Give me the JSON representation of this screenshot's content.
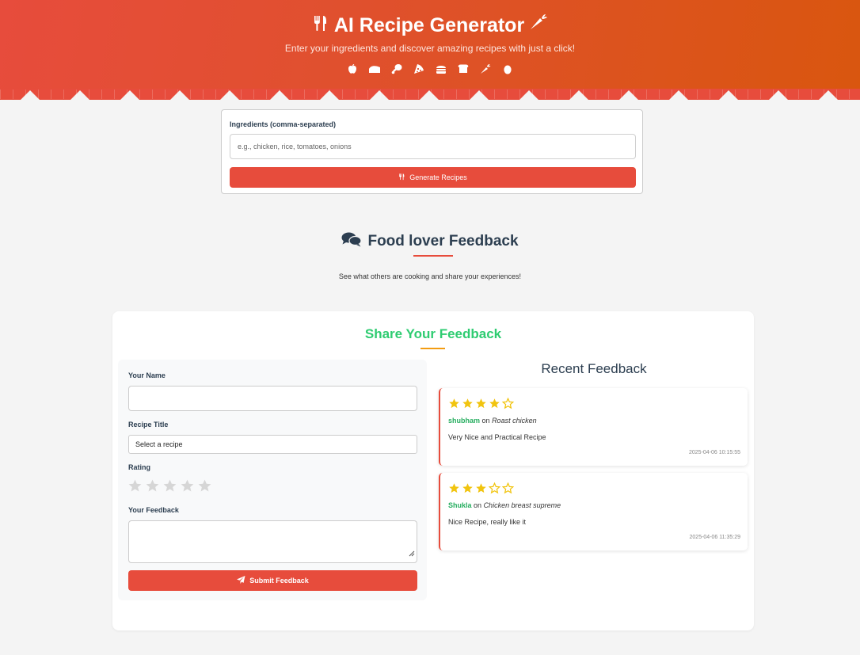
{
  "header": {
    "title": "AI Recipe Generator",
    "subtitle": "Enter your ingredients and discover amazing recipes with just a click!",
    "food_icons": [
      "apple-icon",
      "cheese-icon",
      "drumstick-icon",
      "pizza-icon",
      "burger-icon",
      "bread-icon",
      "carrot-icon",
      "egg-icon"
    ]
  },
  "ingredients": {
    "label": "Ingredients (comma-separated)",
    "placeholder": "e.g., chicken, rice, tomatoes, onions",
    "value": "",
    "generate_label": "Generate Recipes"
  },
  "feedback_section": {
    "title": "Food lover Feedback",
    "subtitle": "See what others are cooking and share your experiences!"
  },
  "share_form": {
    "title": "Share Your Feedback",
    "name_label": "Your Name",
    "name_value": "",
    "recipe_label": "Recipe Title",
    "recipe_selected": "Select a recipe",
    "rating_label": "Rating",
    "rating_value": 0,
    "rating_max": 5,
    "feedback_label": "Your Feedback",
    "feedback_value": "",
    "submit_label": "Submit Feedback"
  },
  "recent": {
    "title": "Recent Feedback",
    "items": [
      {
        "rating": 4,
        "user": "shubham",
        "on": "on",
        "recipe": "Roast chicken",
        "text": "Very Nice and Practical Recipe",
        "date": "2025-04-06 10:15:55"
      },
      {
        "rating": 3,
        "user": "Shukla",
        "on": "on",
        "recipe": "Chicken breast supreme",
        "text": "Nice Recipe, really like it",
        "date": "2025-04-06 11:35:29"
      }
    ]
  },
  "colors": {
    "primary": "#e74c3c",
    "accent_green": "#2ecc71",
    "star_gold": "#f1c40f",
    "star_empty": "#d6d6d6",
    "divider_orange": "#f39c12"
  }
}
